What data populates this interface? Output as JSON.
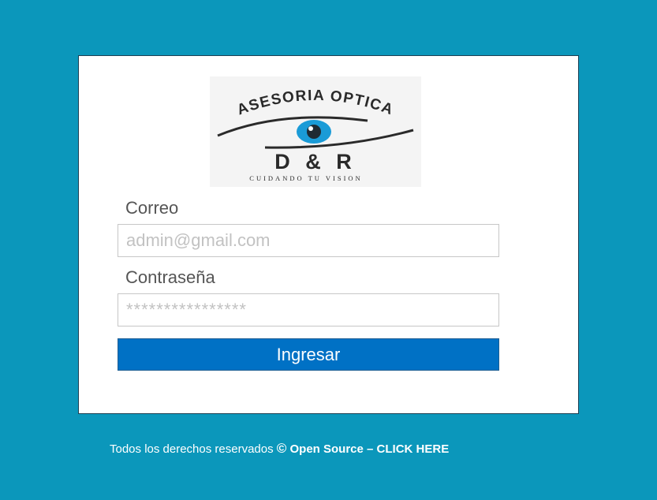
{
  "logo": {
    "title": "ASESORIA OPTICA",
    "brand": "D & R",
    "tagline": "CUIDANDO TU VISION"
  },
  "form": {
    "email_label": "Correo",
    "email_placeholder": "admin@gmail.com",
    "password_label": "Contraseña",
    "password_placeholder": "****************",
    "submit_label": "Ingresar"
  },
  "footer": {
    "text": "Todos los derechos reservados",
    "copyright_symbol": "©",
    "link_text": "Open Source – CLICK HERE"
  },
  "colors": {
    "background": "#0b97bb",
    "card": "#ffffff",
    "button": "#0071c5",
    "eye_iris": "#1a9bd7"
  }
}
